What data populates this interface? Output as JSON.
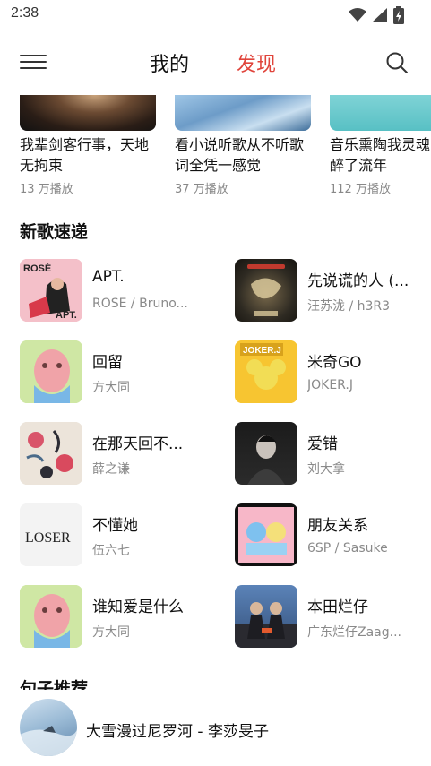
{
  "status": {
    "time": "2:38"
  },
  "nav": {
    "tab_mine": "我的",
    "tab_discover": "发现",
    "menu_icon": "menu-icon",
    "search_icon": "search-icon"
  },
  "playlists": [
    {
      "title": "我辈剑客行事，天地无拘束",
      "plays": "13 万播放"
    },
    {
      "title": "看小说听歌从不听歌词全凭一感觉",
      "plays": "37 万播放"
    },
    {
      "title": "音乐熏陶我灵魂醉了流年",
      "plays": "112 万播放"
    }
  ],
  "sections": {
    "new_songs": "新歌速递",
    "quotes": "句子推荐"
  },
  "songs": [
    {
      "title": "APT.",
      "artist": "ROSÉ / Bruno..."
    },
    {
      "title": "先说谎的人 (...",
      "artist": "汪苏泷 / h3R3"
    },
    {
      "title": "回留",
      "artist": "方大同"
    },
    {
      "title": "米奇GO",
      "artist": "JOKER.J"
    },
    {
      "title": "在那天回不...",
      "artist": "薛之谦"
    },
    {
      "title": "爱错",
      "artist": "刘大拿"
    },
    {
      "title": "不懂她",
      "artist": "伍六七"
    },
    {
      "title": "朋友关系",
      "artist": "6SP / Sasuke"
    },
    {
      "title": "谁知爱是什么",
      "artist": "方大同"
    },
    {
      "title": "本田烂仔",
      "artist": "广东烂仔Zaag..."
    }
  ],
  "cover_texts": {
    "apt": "ROSÉ",
    "apt2": "APT.",
    "joker": "JOKER.J",
    "loser": "LOSER"
  },
  "player": {
    "now_playing": "大雪漫过尼罗河 - 李莎旻子"
  }
}
